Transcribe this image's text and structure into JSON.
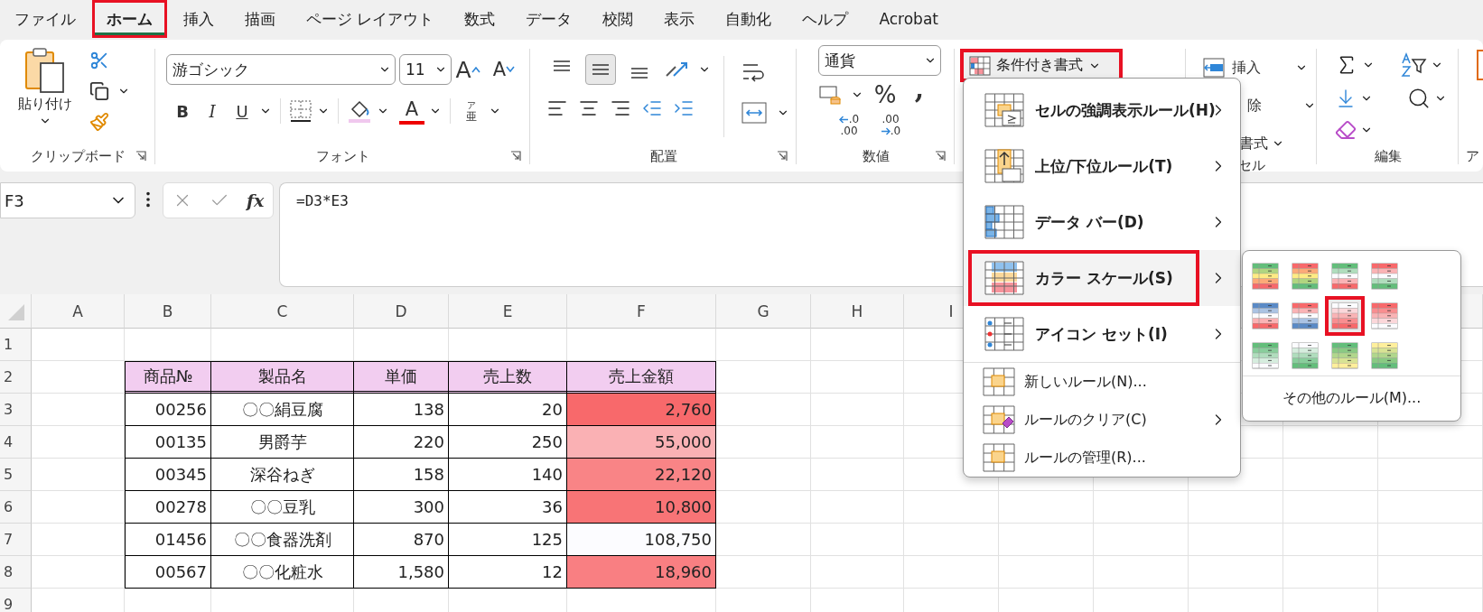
{
  "tabs": [
    {
      "label": "ファイル",
      "selected": false,
      "highlighted": false
    },
    {
      "label": "ホーム",
      "selected": true,
      "highlighted": true
    },
    {
      "label": "挿入",
      "selected": false,
      "highlighted": false
    },
    {
      "label": "描画",
      "selected": false,
      "highlighted": false
    },
    {
      "label": "ページ レイアウト",
      "selected": false,
      "highlighted": false
    },
    {
      "label": "数式",
      "selected": false,
      "highlighted": false
    },
    {
      "label": "データ",
      "selected": false,
      "highlighted": false
    },
    {
      "label": "校閲",
      "selected": false,
      "highlighted": false
    },
    {
      "label": "表示",
      "selected": false,
      "highlighted": false
    },
    {
      "label": "自動化",
      "selected": false,
      "highlighted": false
    },
    {
      "label": "ヘルプ",
      "selected": false,
      "highlighted": false
    },
    {
      "label": "Acrobat",
      "selected": false,
      "highlighted": false
    }
  ],
  "clipboard": {
    "paste": "貼り付け",
    "label": "クリップボード"
  },
  "font": {
    "name": "游ゴシック",
    "size": "11",
    "grow": "A",
    "shrink": "A",
    "styles": [
      "B",
      "I",
      "U"
    ],
    "font_color": "A",
    "phonetic": [
      "ア",
      "亜"
    ],
    "label": "フォント"
  },
  "alignment": {
    "vertical": [
      {
        "selected": false
      },
      {
        "selected": true
      },
      {
        "selected": false
      }
    ],
    "label": "配置"
  },
  "number": {
    "format": "通貨",
    "percent": "%",
    "comma": ",",
    "increase_decimal": [
      ".0",
      ".00"
    ],
    "decrease_decimal": [
      ".00",
      ".0"
    ],
    "label": "数値"
  },
  "styles": {
    "conditional_formatting": {
      "label": "条件付き書式",
      "highlighted": true
    }
  },
  "cells_group": {
    "insert": "挿入",
    "delete": "除",
    "format": "書式",
    "label": "セル"
  },
  "editing": {
    "label": "編集"
  },
  "next_group": {
    "label": "ア"
  },
  "formula_bar": {
    "name_box": "F3",
    "fx": "fx",
    "formula": "=D3*E3"
  },
  "columns": [
    "A",
    "B",
    "C",
    "D",
    "E",
    "F",
    "G",
    "H",
    "I"
  ],
  "row_numbers": [
    "1",
    "2",
    "3",
    "4",
    "5",
    "6",
    "7",
    "8",
    "9"
  ],
  "table": {
    "headers": [
      "商品№",
      "製品名",
      "単価",
      "売上数",
      "売上金額"
    ],
    "rows": [
      {
        "cells": [
          "00256",
          "〇〇絹豆腐",
          "138",
          "20",
          "2,760"
        ],
        "color": "#f8696b"
      },
      {
        "cells": [
          "00135",
          "男爵芋",
          "220",
          "250",
          "55,000"
        ],
        "color": "#fab1b4"
      },
      {
        "cells": [
          "00345",
          "深谷ねぎ",
          "158",
          "140",
          "22,120"
        ],
        "color": "#f98486"
      },
      {
        "cells": [
          "00278",
          "〇〇豆乳",
          "300",
          "36",
          "10,800"
        ],
        "color": "#f87476"
      },
      {
        "cells": [
          "01456",
          "〇〇食器洗剤",
          "870",
          "125",
          "108,750"
        ],
        "color": "#fcfcff"
      },
      {
        "cells": [
          "00567",
          "〇〇化粧水",
          "1,580",
          "12",
          "18,960"
        ],
        "color": "#f97f82"
      }
    ]
  },
  "conditional_menu": {
    "items": [
      {
        "kind": "highlight",
        "label": "セルの強調表示ルール(H)",
        "submenu": true,
        "selected": false,
        "highlighted": false
      },
      {
        "kind": "topbottom",
        "label": "上位/下位ルール(T)",
        "submenu": true,
        "selected": false,
        "highlighted": false
      },
      {
        "kind": "databar",
        "label": "データ バー(D)",
        "submenu": true,
        "selected": false,
        "highlighted": false
      },
      {
        "kind": "colorscale",
        "label": "カラー スケール(S)",
        "submenu": true,
        "selected": true,
        "highlighted": true
      },
      {
        "kind": "iconset",
        "label": "アイコン セット(I)",
        "submenu": true,
        "selected": false,
        "highlighted": false
      },
      {
        "kind": "new",
        "label": "新しいルール(N)...",
        "submenu": false,
        "selected": false,
        "highlighted": false
      },
      {
        "kind": "clear",
        "label": "ルールのクリア(C)",
        "submenu": true,
        "selected": false,
        "highlighted": false
      },
      {
        "kind": "manage",
        "label": "ルールの管理(R)...",
        "submenu": false,
        "selected": false,
        "highlighted": false
      }
    ]
  },
  "color_scales": {
    "swatches": [
      {
        "bands": [
          {
            "color": "#63be7b"
          },
          {
            "color": "#ffeb84"
          },
          {
            "color": "#f8696b"
          }
        ],
        "selected": false,
        "highlighted": false
      },
      {
        "bands": [
          {
            "color": "#f8696b"
          },
          {
            "color": "#ffeb84"
          },
          {
            "color": "#63be7b"
          }
        ],
        "selected": false,
        "highlighted": false
      },
      {
        "bands": [
          {
            "color": "#63be7b"
          },
          {
            "color": "#fcfcff"
          },
          {
            "color": "#f8696b"
          }
        ],
        "selected": false,
        "highlighted": false
      },
      {
        "bands": [
          {
            "color": "#f8696b"
          },
          {
            "color": "#fcfcff"
          },
          {
            "color": "#63be7b"
          }
        ],
        "selected": false,
        "highlighted": false
      },
      {
        "bands": [
          {
            "color": "#5a8ac6"
          },
          {
            "color": "#fcfcff"
          },
          {
            "color": "#f8696b"
          }
        ],
        "selected": false,
        "highlighted": false
      },
      {
        "bands": [
          {
            "color": "#f8696b"
          },
          {
            "color": "#fcfcff"
          },
          {
            "color": "#5a8ac6"
          }
        ],
        "selected": false,
        "highlighted": false
      },
      {
        "bands": [
          {
            "color": "#fcfcff"
          },
          {
            "color": "#f8696b"
          }
        ],
        "selected": true,
        "highlighted": true
      },
      {
        "bands": [
          {
            "color": "#f8696b"
          },
          {
            "color": "#fcfcff"
          }
        ],
        "selected": false,
        "highlighted": false
      },
      {
        "bands": [
          {
            "color": "#63be7b"
          },
          {
            "color": "#fcfcff"
          }
        ],
        "selected": false,
        "highlighted": false
      },
      {
        "bands": [
          {
            "color": "#fcfcff"
          },
          {
            "color": "#63be7b"
          }
        ],
        "selected": false,
        "highlighted": false
      },
      {
        "bands": [
          {
            "color": "#63be7b"
          },
          {
            "color": "#ffef9c"
          }
        ],
        "selected": false,
        "highlighted": false
      },
      {
        "bands": [
          {
            "color": "#ffef9c"
          },
          {
            "color": "#63be7b"
          }
        ],
        "selected": false,
        "highlighted": false
      }
    ],
    "more_rules": "その他のルール(M)..."
  }
}
